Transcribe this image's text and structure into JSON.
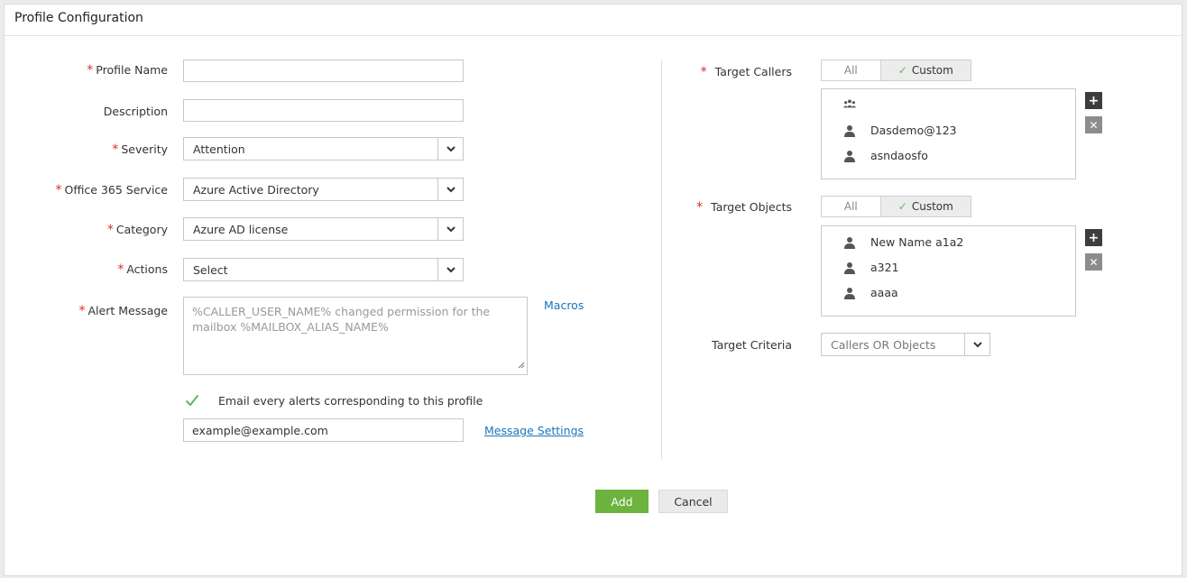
{
  "page": {
    "title": "Profile Configuration"
  },
  "form": {
    "profile_name": {
      "label": "Profile Name",
      "value": ""
    },
    "description": {
      "label": "Description",
      "value": ""
    },
    "severity": {
      "label": "Severity",
      "value": "Attention"
    },
    "office_service": {
      "label": "Office 365 Service",
      "value": "Azure Active Directory"
    },
    "category": {
      "label": "Category",
      "value": "Azure AD license"
    },
    "actions": {
      "label": "Actions",
      "value": "Select"
    },
    "alert_message": {
      "label": "Alert Message",
      "placeholder": "%CALLER_USER_NAME% changed permission for the mailbox %MAILBOX_ALIAS_NAME%",
      "macros_link": "Macros"
    },
    "email": {
      "checkbox_label": "Email every alerts corresponding to this profile",
      "checked": true,
      "value": "example@example.com",
      "settings_link": "Message Settings"
    }
  },
  "targets": {
    "callers": {
      "label": "Target Callers",
      "options": [
        "All",
        "Custom"
      ],
      "selected": "Custom",
      "items": [
        {
          "icon": "group-icon",
          "text": ""
        },
        {
          "icon": "user-icon",
          "text": "Dasdemo@123"
        },
        {
          "icon": "user-icon",
          "text": "asndaosfo"
        }
      ]
    },
    "objects": {
      "label": "Target Objects",
      "options": [
        "All",
        "Custom"
      ],
      "selected": "Custom",
      "items": [
        {
          "icon": "user-icon",
          "text": "New Name a1a2"
        },
        {
          "icon": "user-icon",
          "text": "a321"
        },
        {
          "icon": "user-icon",
          "text": "aaaa"
        }
      ]
    },
    "criteria": {
      "label": "Target Criteria",
      "value": "Callers OR Objects"
    }
  },
  "buttons": {
    "add": "Add",
    "cancel": "Cancel"
  },
  "colors": {
    "accent": "#6cb33f",
    "link": "#1a75bb",
    "required": "#e0282b"
  }
}
